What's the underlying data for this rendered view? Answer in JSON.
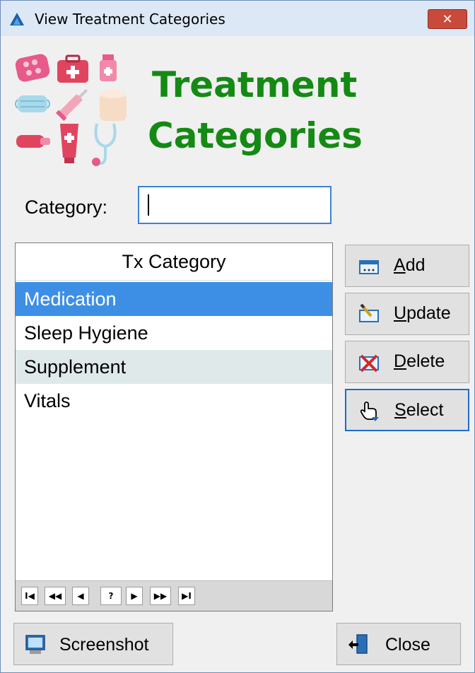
{
  "window": {
    "title": "View Treatment Categories",
    "close_glyph": "✕"
  },
  "heading": {
    "line1": "Treatment",
    "line2": "Categories"
  },
  "category": {
    "label": "Category:",
    "value": ""
  },
  "grid": {
    "header": "Tx Category",
    "rows": [
      "Medication",
      "Sleep Hygiene",
      "Supplement",
      "Vitals"
    ],
    "selected_row": 0
  },
  "navigator": {
    "first": "I◀",
    "prior_page": "◀◀",
    "prior": "◀",
    "refresh": "?",
    "next": "▶",
    "next_page": "▶▶",
    "last": "▶I"
  },
  "buttons": {
    "add": "Add",
    "update": "Update",
    "delete": "Delete",
    "select": "Select",
    "screenshot": "Screenshot",
    "close": "Close"
  },
  "colors": {
    "heading": "#148a14",
    "selection": "#3d8fe6",
    "alt_row": "#dfe9e9",
    "focus_border": "#1e6cc8"
  },
  "icons": {
    "app": "app-triangle-icon",
    "logo": "medical-supplies-icon",
    "add": "add-icon",
    "update": "edit-icon",
    "delete": "delete-icon",
    "select": "hand-pointer-icon",
    "screenshot": "monitor-icon",
    "close": "exit-door-icon"
  }
}
